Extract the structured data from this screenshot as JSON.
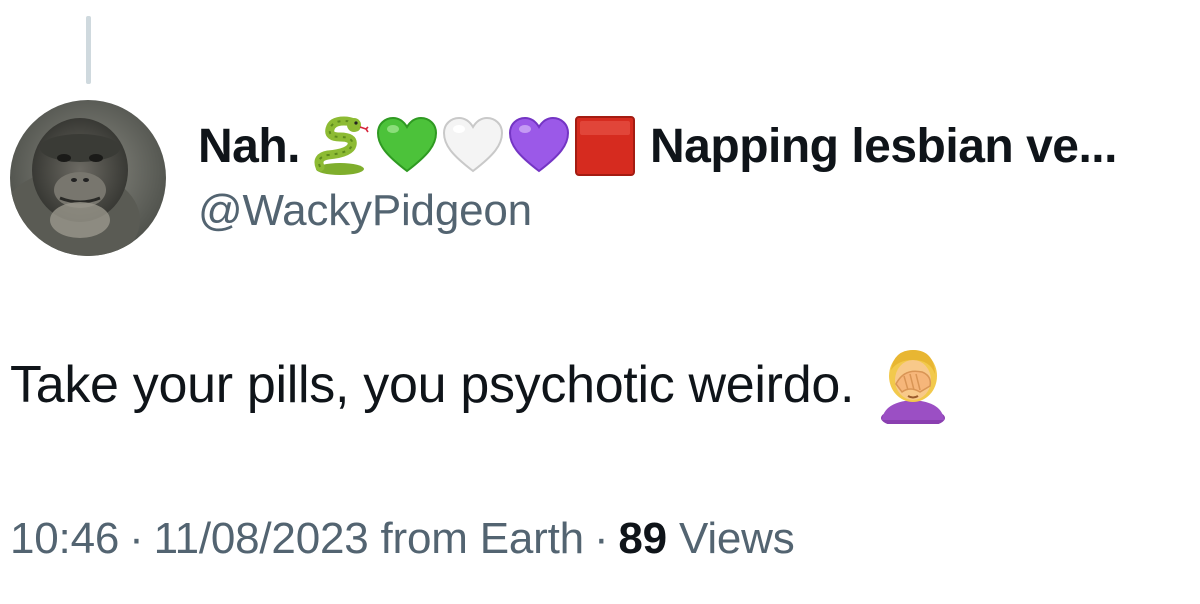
{
  "author": {
    "display_name": "Nah.",
    "name_emojis": [
      "snake-emoji",
      "green-heart-emoji",
      "white-heart-emoji",
      "purple-heart-emoji",
      "red-square-emoji"
    ],
    "display_name_suffix": "Napping lesbian ve...",
    "handle": "@WackyPidgeon"
  },
  "tweet": {
    "text": "Take your pills, you psychotic weirdo.",
    "trailing_emoji": "woman-facepalming-emoji"
  },
  "meta": {
    "time": "10:46",
    "separator": "·",
    "date": "11/08/2023 from Earth",
    "views_count": "89",
    "views_label": "Views"
  },
  "colors": {
    "text_primary": "#0f1419",
    "text_secondary": "#536471",
    "thread_line": "#cfd9de"
  }
}
